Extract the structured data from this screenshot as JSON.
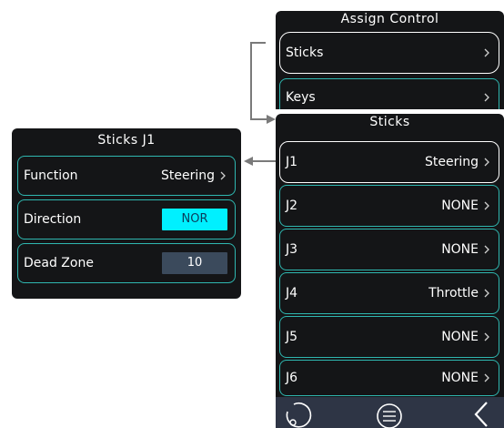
{
  "assign_panel": {
    "title": "Assign Control",
    "items": [
      {
        "label": "Sticks"
      },
      {
        "label": "Keys"
      }
    ]
  },
  "sticks_panel": {
    "title": "Sticks",
    "items": [
      {
        "label": "J1",
        "value": "Steering"
      },
      {
        "label": "J2",
        "value": "NONE"
      },
      {
        "label": "J3",
        "value": "NONE"
      },
      {
        "label": "J4",
        "value": "Throttle"
      },
      {
        "label": "J5",
        "value": "NONE"
      },
      {
        "label": "J6",
        "value": "NONE"
      }
    ]
  },
  "detail_panel": {
    "title": "Sticks J1",
    "function_label": "Function",
    "function_value": "Steering",
    "direction_label": "Direction",
    "direction_value": "NOR",
    "deadzone_label": "Dead Zone",
    "deadzone_value": "10"
  },
  "bottom_bar": {
    "icons": [
      "reset-icon",
      "menu-icon",
      "back-icon"
    ]
  },
  "colors": {
    "panel_bg": "#141517",
    "row_border": "#2fb7b0",
    "selected_border": "#ffffff",
    "direction_pill": "#00f0ff",
    "deadzone_pill": "#3b4a5c",
    "bottom_bar": "#2e3545",
    "connector": "#7a7a7a"
  }
}
